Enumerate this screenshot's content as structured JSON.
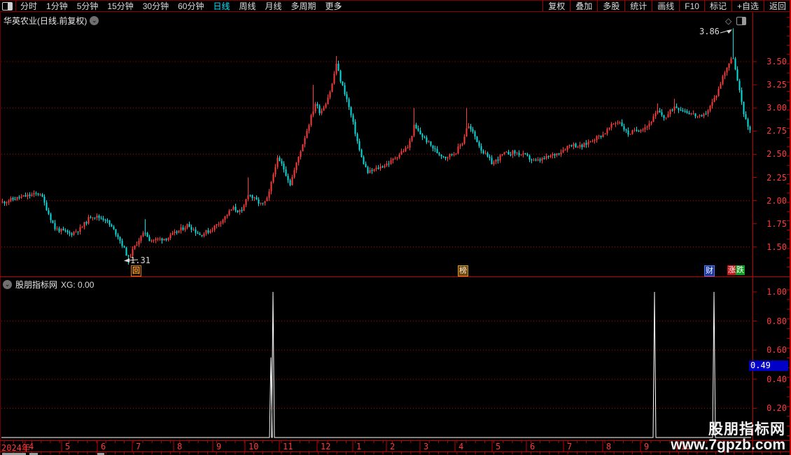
{
  "menubar": {
    "left_items": [
      "分时",
      "1分钟",
      "5分钟",
      "15分钟",
      "30分钟",
      "60分钟",
      "日线",
      "周线",
      "月线",
      "多周期",
      "更多"
    ],
    "active_item": "日线",
    "more_arrow": "›",
    "right_items": [
      "复权",
      "叠加",
      "多股",
      "统计",
      "画线",
      "F10",
      "标记",
      "+自选",
      "返回"
    ]
  },
  "chart_header": {
    "title": "华英农业(日线.前复权)",
    "collapse_glyph": "⌄"
  },
  "pane_icons": {
    "diamond": "◇"
  },
  "annotations": {
    "high_label": "3.86",
    "low_label": "1.31"
  },
  "badges": [
    {
      "label": "回",
      "x": 187,
      "theme": "gold"
    },
    {
      "label": "榜",
      "x": 654,
      "theme": "brown"
    },
    {
      "label": "财",
      "x": 1006,
      "theme": "blue"
    },
    {
      "label": "涨",
      "x": 1039,
      "theme": "red"
    },
    {
      "label": "跌",
      "x": 1051,
      "theme": "green"
    }
  ],
  "indicator_header": {
    "name": "股朋指标网",
    "value_text": "XG: 0.00",
    "collapse_glyph": "⌄"
  },
  "indicator_marker": {
    "label": "0.49",
    "value": 0.49
  },
  "watermark": {
    "line1": "股朋指标网",
    "line2": "www.7gpzb.com"
  },
  "date_axis": {
    "months": [
      {
        "label": "2024年",
        "x": 2
      },
      {
        "label": "4",
        "x": 41
      },
      {
        "label": "5",
        "x": 93
      },
      {
        "label": "6",
        "x": 144
      },
      {
        "label": "7",
        "x": 194
      },
      {
        "label": "8",
        "x": 253
      },
      {
        "label": "9",
        "x": 309
      },
      {
        "label": "10",
        "x": 355
      },
      {
        "label": "11",
        "x": 404
      },
      {
        "label": "12",
        "x": 458
      },
      {
        "label": "1",
        "x": 509
      },
      {
        "label": "2",
        "x": 557
      },
      {
        "label": "3",
        "x": 605
      },
      {
        "label": "4",
        "x": 655
      },
      {
        "label": "5",
        "x": 708
      },
      {
        "label": "6",
        "x": 757
      },
      {
        "label": "7",
        "x": 810
      },
      {
        "label": "8",
        "x": 866
      },
      {
        "label": "9",
        "x": 920
      },
      {
        "label": "10",
        "x": 972
      }
    ]
  },
  "chart_data": {
    "type": "candlestick",
    "title": "华英农业(日线.前复权)",
    "period": "daily, forward-adjusted",
    "ylim": [
      1.31,
      3.86
    ],
    "price_axis_values": [
      3.5,
      3.25,
      3.0,
      2.75,
      2.5,
      2.25,
      2.0,
      1.75,
      1.5
    ],
    "main_gridlines": [
      3.5,
      3.0,
      2.5,
      2.0,
      1.5
    ],
    "high_annotation": {
      "x": 1047,
      "price": 3.86
    },
    "low_annotation": {
      "x": 183,
      "price": 1.31
    },
    "price_keypoints": [
      [
        2,
        1.98
      ],
      [
        25,
        2.03
      ],
      [
        57,
        2.08
      ],
      [
        68,
        1.88
      ],
      [
        78,
        1.7
      ],
      [
        100,
        1.64
      ],
      [
        115,
        1.7
      ],
      [
        130,
        1.84
      ],
      [
        150,
        1.8
      ],
      [
        168,
        1.62
      ],
      [
        183,
        1.38
      ],
      [
        196,
        1.56
      ],
      [
        207,
        1.66
      ],
      [
        214,
        1.57
      ],
      [
        240,
        1.6
      ],
      [
        268,
        1.74
      ],
      [
        285,
        1.63
      ],
      [
        300,
        1.68
      ],
      [
        318,
        1.8
      ],
      [
        332,
        1.92
      ],
      [
        345,
        1.87
      ],
      [
        354,
        2.08
      ],
      [
        362,
        2.02
      ],
      [
        374,
        1.95
      ],
      [
        382,
        2.02
      ],
      [
        395,
        2.45
      ],
      [
        403,
        2.38
      ],
      [
        414,
        2.18
      ],
      [
        428,
        2.52
      ],
      [
        443,
        2.88
      ],
      [
        450,
        3.05
      ],
      [
        457,
        2.95
      ],
      [
        465,
        3.06
      ],
      [
        473,
        3.22
      ],
      [
        480,
        3.48
      ],
      [
        485,
        3.32
      ],
      [
        494,
        3.12
      ],
      [
        505,
        2.8
      ],
      [
        515,
        2.48
      ],
      [
        525,
        2.3
      ],
      [
        542,
        2.36
      ],
      [
        558,
        2.42
      ],
      [
        572,
        2.52
      ],
      [
        583,
        2.58
      ],
      [
        591,
        2.8
      ],
      [
        600,
        2.72
      ],
      [
        612,
        2.62
      ],
      [
        624,
        2.52
      ],
      [
        636,
        2.47
      ],
      [
        650,
        2.52
      ],
      [
        661,
        2.64
      ],
      [
        667,
        2.82
      ],
      [
        676,
        2.72
      ],
      [
        688,
        2.54
      ],
      [
        703,
        2.4
      ],
      [
        718,
        2.5
      ],
      [
        733,
        2.52
      ],
      [
        748,
        2.49
      ],
      [
        764,
        2.42
      ],
      [
        780,
        2.46
      ],
      [
        798,
        2.52
      ],
      [
        815,
        2.61
      ],
      [
        830,
        2.58
      ],
      [
        846,
        2.66
      ],
      [
        862,
        2.72
      ],
      [
        876,
        2.83
      ],
      [
        884,
        2.86
      ],
      [
        896,
        2.72
      ],
      [
        910,
        2.76
      ],
      [
        925,
        2.81
      ],
      [
        939,
        2.96
      ],
      [
        950,
        2.89
      ],
      [
        963,
        3.02
      ],
      [
        975,
        2.98
      ],
      [
        990,
        2.93
      ],
      [
        1002,
        2.89
      ],
      [
        1013,
        3.0
      ],
      [
        1024,
        3.16
      ],
      [
        1034,
        3.38
      ],
      [
        1042,
        3.5
      ],
      [
        1047,
        3.55
      ],
      [
        1052,
        3.32
      ],
      [
        1058,
        3.1
      ],
      [
        1064,
        2.88
      ],
      [
        1069,
        2.78
      ]
    ],
    "wick_overrides": [
      {
        "x": 183,
        "low": 1.31
      },
      {
        "x": 207,
        "high": 1.8
      },
      {
        "x": 354,
        "high": 2.25
      },
      {
        "x": 447,
        "high": 3.25
      },
      {
        "x": 480,
        "high": 3.56
      },
      {
        "x": 591,
        "high": 3.0
      },
      {
        "x": 666,
        "high": 3.0
      },
      {
        "x": 939,
        "high": 3.05
      },
      {
        "x": 963,
        "high": 3.1
      },
      {
        "x": 1047,
        "high": 3.86
      }
    ],
    "indicator": {
      "name": "股朋指标网",
      "series": "XG",
      "current": 0.0,
      "axis_values": [
        1.0,
        0.8,
        0.6,
        0.4,
        0.2
      ],
      "gridlines": [
        0.8,
        0.6,
        0.4,
        0.2
      ],
      "spikes": [
        {
          "x": 387,
          "v": 0.55
        },
        {
          "x": 390,
          "v": 1.0
        },
        {
          "x": 935,
          "v": 1.0
        },
        {
          "x": 1020,
          "v": 1.0
        }
      ]
    },
    "colors": {
      "up": "#ff3a3a",
      "down": "#00e1e1",
      "axis_text": "#ff3a3a",
      "grid": "#b40000",
      "frame": "#c00000",
      "indicator_line": "#ffffff",
      "marker_bg": "#0000c6"
    }
  }
}
